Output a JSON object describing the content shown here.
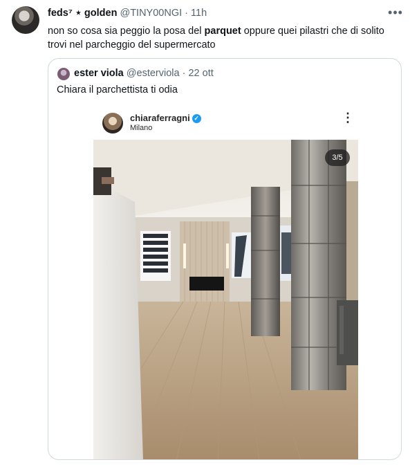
{
  "tweet": {
    "author_name": "feds⁷ ⋆ golden",
    "handle": "@TINY00NGI",
    "separator": "·",
    "time": "11h",
    "text_before": "non so cosa sia peggio la posa del ",
    "text_bold": "parquet",
    "text_after": " oppure quei pilastri che di solito trovi nel parcheggio del supermercato",
    "more_icon": "more-horizontal-icon"
  },
  "quote": {
    "author_name": "ester viola",
    "handle": "@esterviola",
    "separator": "·",
    "date": "22 ott",
    "text": "Chiara il parchettista ti odia"
  },
  "instagram": {
    "username": "chiaraferragni",
    "location": "Milano",
    "verified_icon": "verified-badge-icon",
    "more_icon": "more-vertical-icon",
    "counter": "3/5"
  },
  "colors": {
    "text": "#0f1419",
    "secondary": "#536471",
    "border": "#cfd9de",
    "verified": "#1d9bf0"
  }
}
